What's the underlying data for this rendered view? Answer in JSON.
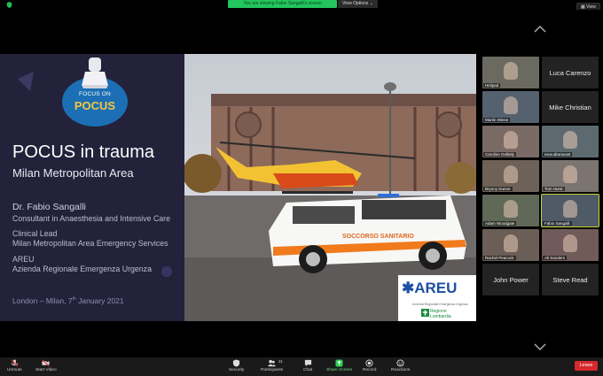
{
  "top_bar": {
    "viewing_text": "You are viewing Fabio Sangalli's screen",
    "view_options_label": "View Options ⌄",
    "view_label": "View"
  },
  "slide": {
    "logo_line1": "FOCUS ON",
    "logo_line2": "POCUS",
    "title": "POCUS in trauma",
    "subtitle": "Milan Metropolitan Area",
    "presenter": "Dr. Fabio Sangalli",
    "role": "Consultant in Anaesthesia and Intensive Care",
    "lead_title": "Clinical Lead",
    "lead_org": "Milan Metropolitan Area Emergency Services",
    "areu_short": "AREU",
    "areu_full": "Azienda Regionale Emergenza Urgenza",
    "footer_location": "London – Milan, 7",
    "footer_sup": "th",
    "footer_date": " January 2021",
    "ambulance_text": "SOCCORSO SANITARIO",
    "logo_areu": "AREU",
    "logo_areu_sub": "Azienda Regionale Emergenza Urgenza",
    "logo_region_1": "Regione",
    "logo_region_2": "Lombardia"
  },
  "participants": [
    {
      "name": "Helipad",
      "type": "video"
    },
    {
      "name": "Luca Carenzo",
      "type": "name"
    },
    {
      "name": "Martin Wiese",
      "type": "video"
    },
    {
      "name": "Mike Christian",
      "type": "name"
    },
    {
      "name": "Caroline Gellatly",
      "type": "video"
    },
    {
      "name": "ewoudtaravast",
      "type": "video"
    },
    {
      "name": "Bryony Dunne",
      "type": "video"
    },
    {
      "name": "Tom Hurst",
      "type": "video"
    },
    {
      "name": "Adam Woodgate",
      "type": "video"
    },
    {
      "name": "Fabio Sangalli",
      "type": "video"
    },
    {
      "name": "Rachel Peacock",
      "type": "video"
    },
    {
      "name": "Ali Sanders",
      "type": "video"
    },
    {
      "name": "John Power",
      "type": "name"
    },
    {
      "name": "Steve Read",
      "type": "name"
    }
  ],
  "toolbar": {
    "unmute": "Unmute",
    "start_video": "Start Video",
    "security": "Security",
    "participants": "Participants",
    "participants_count": "31",
    "chat": "Chat",
    "share_screen": "Share Screen",
    "record": "Record",
    "reactions": "Reactions",
    "leave": "Leave"
  },
  "colors": {
    "accent_green": "#22c55e",
    "leave_red": "#d6292d",
    "slide_bg": "#23223a",
    "pocus_yellow": "#f6c63e"
  }
}
